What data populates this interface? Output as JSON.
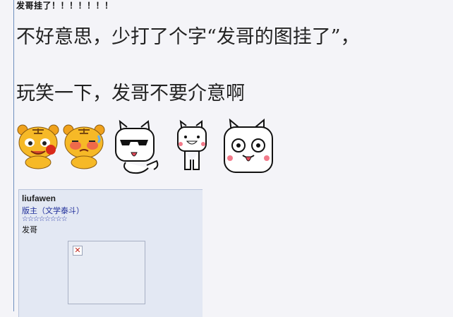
{
  "post": {
    "title": "发哥挂了！！！！！！！",
    "line1": "不好意思，少打了个字“发哥的图挂了”，",
    "line2": "玩笑一下，发哥不要介意啊"
  },
  "emoticons": [
    "tiger-smile-icon",
    "tiger-blush-icon",
    "bunny-sunglasses-icon",
    "bunny-grin-icon",
    "bunny-tongue-icon"
  ],
  "profile": {
    "username": "liufawen",
    "rank": "版主（文学泰斗）",
    "stars": "☆☆☆☆☆☆☆☆",
    "nickname": "发哥"
  },
  "avatar": {
    "state": "broken-image-icon"
  }
}
